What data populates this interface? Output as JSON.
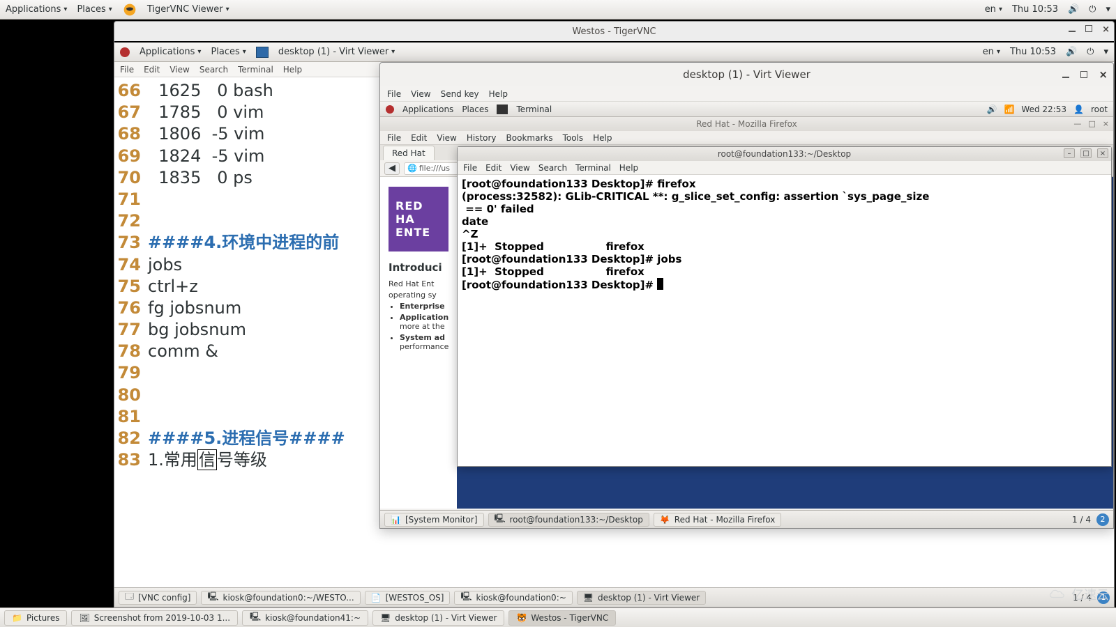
{
  "host_panel": {
    "applications": "Applications",
    "places": "Places",
    "app": "TigerVNC Viewer",
    "lang": "en",
    "clock": "Thu 10:53"
  },
  "tigervnc_window": {
    "title": "Westos - TigerVNC"
  },
  "guest_panel": {
    "applications": "Applications",
    "places": "Places",
    "app": "desktop (1) - Virt Viewer",
    "lang": "en",
    "clock": "Thu 10:53"
  },
  "editor": {
    "menu": {
      "file": "File",
      "edit": "Edit",
      "view": "View",
      "search": "Search",
      "terminal": "Terminal",
      "help": "Help"
    },
    "lines": [
      {
        "n": "66",
        "t": "  1625   0 bash"
      },
      {
        "n": "67",
        "t": "  1785   0 vim"
      },
      {
        "n": "68",
        "t": "  1806  -5 vim"
      },
      {
        "n": "69",
        "t": "  1824  -5 vim"
      },
      {
        "n": "70",
        "t": "  1835   0 ps"
      },
      {
        "n": "71",
        "t": ""
      },
      {
        "n": "72",
        "t": ""
      },
      {
        "n": "73",
        "t": "####4.环境中进程的前",
        "hdr": true
      },
      {
        "n": "74",
        "t": "jobs"
      },
      {
        "n": "75",
        "t": "ctrl+z"
      },
      {
        "n": "76",
        "t": "fg jobsnum"
      },
      {
        "n": "77",
        "t": "bg jobsnum"
      },
      {
        "n": "78",
        "t": "comm &"
      },
      {
        "n": "79",
        "t": ""
      },
      {
        "n": "80",
        "t": ""
      },
      {
        "n": "81",
        "t": ""
      },
      {
        "n": "82",
        "t": "####5.进程信号####",
        "hdr": true
      },
      {
        "n": "83",
        "t": "1.常用信号等级",
        "cursor_after": "信"
      }
    ]
  },
  "virt": {
    "title": "desktop (1) - Virt Viewer",
    "menu": {
      "file": "File",
      "view": "View",
      "sendkey": "Send key",
      "help": "Help"
    },
    "panel": {
      "applications": "Applications",
      "places": "Places",
      "app": "Terminal",
      "clock": "Wed 22:53",
      "user": "root"
    }
  },
  "firefox": {
    "title": "Red Hat - Mozilla Firefox",
    "menu": {
      "file": "File",
      "edit": "Edit",
      "view": "View",
      "history": "History",
      "bookmarks": "Bookmarks",
      "tools": "Tools",
      "help": "Help"
    },
    "tab": "Red Hat",
    "url": "file:///us",
    "banner1": "RED HA",
    "banner2": "ENTE",
    "h3": "Introduci",
    "p1": "Red Hat Ent",
    "p2": "operating sy",
    "li1": "Enterprise",
    "li2": "Application",
    "li2b": "more at the",
    "li3": "System ad",
    "li3b": "performance"
  },
  "terminal": {
    "title": "root@foundation133:~/Desktop",
    "menu": {
      "file": "File",
      "edit": "Edit",
      "view": "View",
      "search": "Search",
      "terminal": "Terminal",
      "help": "Help"
    },
    "lines": [
      "[root@foundation133 Desktop]# firefox",
      "",
      "(process:32582): GLib-CRITICAL **: g_slice_set_config: assertion `sys_page_size",
      " == 0' failed",
      "",
      "",
      "date",
      "^Z",
      "[1]+  Stopped                 firefox",
      "[root@foundation133 Desktop]# jobs",
      "[1]+  Stopped                 firefox",
      "[root@foundation133 Desktop]# "
    ]
  },
  "virt_taskbar": {
    "t1": "[System Monitor]",
    "t2": "root@foundation133:~/Desktop",
    "t3": "Red Hat - Mozilla Firefox",
    "ws": "1 / 4"
  },
  "guest_taskbar": {
    "t1": "[VNC config]",
    "t2": "kiosk@foundation0:~/WESTO...",
    "t3": "[WESTOS_OS]",
    "t4": "kiosk@foundation0:~",
    "t5": "desktop (1) - Virt Viewer",
    "ws": "1 / 4"
  },
  "host_taskbar": {
    "t1": "Pictures",
    "t2": "Screenshot from 2019-10-03 1...",
    "t3": "kiosk@foundation41:~",
    "t4": "desktop (1) - Virt Viewer",
    "t5": "Westos - TigerVNC"
  },
  "watermark": "亿速云"
}
